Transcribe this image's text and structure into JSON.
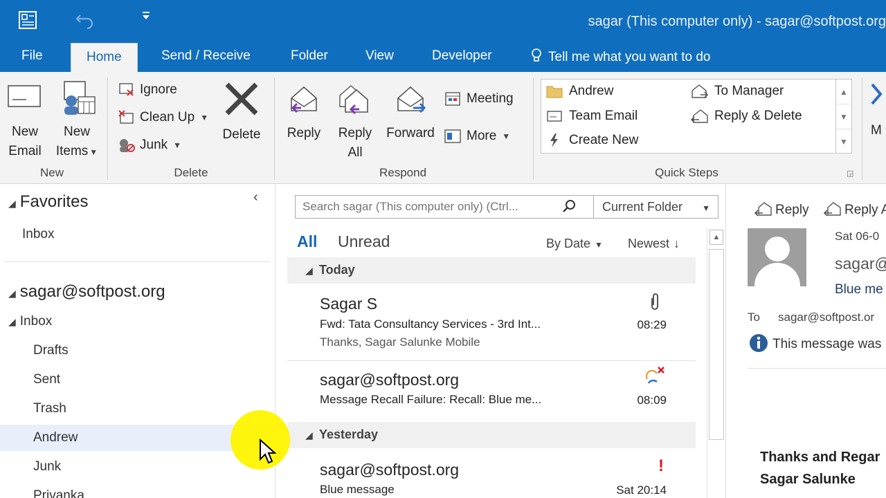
{
  "window": {
    "title": "sagar (This computer only) - sagar@softpost.org"
  },
  "tabs": [
    {
      "label": "File"
    },
    {
      "label": "Home"
    },
    {
      "label": "Send / Receive"
    },
    {
      "label": "Folder"
    },
    {
      "label": "View"
    },
    {
      "label": "Developer"
    }
  ],
  "tell_me": "Tell me what you want to do",
  "ribbon": {
    "new_group": {
      "new_email": [
        "New",
        "Email"
      ],
      "new_items": [
        "New",
        "Items"
      ],
      "label": "New"
    },
    "delete_group": {
      "ignore": "Ignore",
      "clean_up": "Clean Up",
      "junk": "Junk",
      "delete": "Delete",
      "label": "Delete"
    },
    "respond_group": {
      "reply": "Reply",
      "reply_all": [
        "Reply",
        "All"
      ],
      "forward": "Forward",
      "meeting": "Meeting",
      "more": "More",
      "label": "Respond"
    },
    "quick_steps": {
      "items": [
        "Andrew",
        "Team Email",
        "Create New",
        "To Manager",
        "Reply & Delete"
      ],
      "label": "Quick Steps"
    },
    "partial_button": "M"
  },
  "folder_pane": {
    "favorites": "Favorites",
    "fav_inbox": "Inbox",
    "account": "sagar@softpost.org",
    "inbox": "Inbox",
    "folders": [
      "Drafts",
      "Sent",
      "Trash",
      "Andrew",
      "Junk",
      "Privanka"
    ]
  },
  "message_list": {
    "search_placeholder": "Search sagar (This computer only) (Ctrl...",
    "scope": "Current Folder",
    "filter_all": "All",
    "filter_unread": "Unread",
    "sort_by": "By Date",
    "order": "Newest",
    "groups": [
      "Today",
      "Yesterday"
    ],
    "messages": [
      {
        "from": "Sagar S",
        "subject": "Fwd: Tata Consultancy Services - 3rd Int...",
        "preview": "Thanks,  Sagar Salunke  Mobile",
        "time": "08:29"
      },
      {
        "from": "sagar@softpost.org",
        "subject": "Message Recall Failure: Recall: Blue me...",
        "preview": "",
        "time": "08:09"
      },
      {
        "from": "sagar@softpost.org",
        "subject": "Blue message",
        "preview": "",
        "time": "Sat 20:14"
      }
    ]
  },
  "reading_pane": {
    "reply": "Reply",
    "reply_all": "Reply A",
    "date": "Sat 06-0",
    "sender": "sagar@",
    "subject": "Blue me",
    "to_label": "To",
    "to_value": "sagar@softpost.or",
    "info": "This message was",
    "body_line1": "Thanks and Regar",
    "body_line2": "Sagar Salunke"
  },
  "colors": {
    "title_blue": "#106ebe",
    "ribbon_bg": "#f3f3f3",
    "accent_blue": "#1565b8",
    "flag_red": "#e81123",
    "cursor_highlight": "#fff400"
  }
}
